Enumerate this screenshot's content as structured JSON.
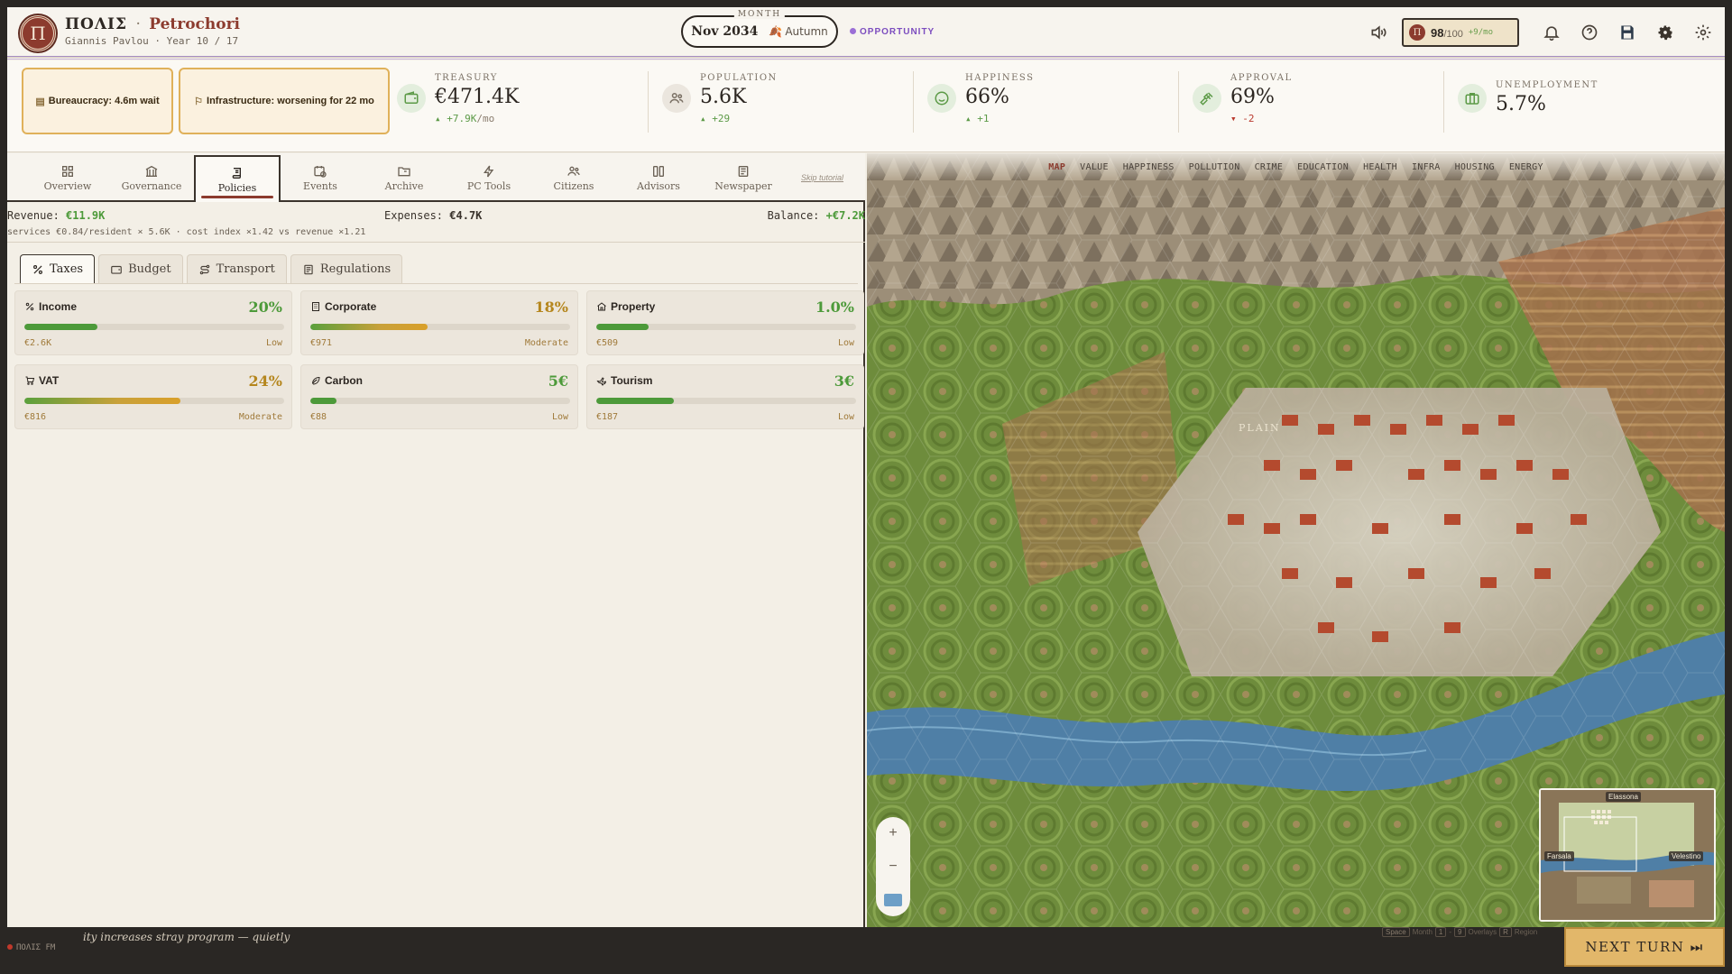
{
  "header": {
    "logo_letter": "Π",
    "game_name": "ΠΟΛΙΣ",
    "separator": "·",
    "city_name": "Petrochori",
    "mayor": "Giannis Pavlou",
    "year": "Year 10 / 17",
    "month_label": "MONTH",
    "date": "Nov 2034",
    "season": "Autumn",
    "opportunity": "OPPORTUNITY",
    "score": "98",
    "score_max": "/100",
    "score_rate": "+9/mo"
  },
  "alerts": [
    {
      "text": "Bureaucracy: 4.6m wait",
      "icon": "clipboard-icon"
    },
    {
      "text": "Infrastructure: worsening for 22 mo",
      "icon": "construction-icon"
    }
  ],
  "stats": {
    "treasury": {
      "label": "TREASURY",
      "value": "€471.4K",
      "delta": "▴ +7.9K",
      "unit": "/mo"
    },
    "population": {
      "label": "POPULATION",
      "value": "5.6K",
      "delta": "▴ +29"
    },
    "happiness": {
      "label": "HAPPINESS",
      "value": "66%",
      "delta": "▴ +1"
    },
    "approval": {
      "label": "APPROVAL",
      "value": "69%",
      "delta": "▾ -2"
    },
    "unemployment": {
      "label": "UNEMPLOYMENT",
      "value": "5.7%"
    }
  },
  "tabs": [
    "Overview",
    "Governance",
    "Policies",
    "Events",
    "Archive",
    "PC Tools",
    "Citizens",
    "Advisors",
    "Newspaper"
  ],
  "skip_tutorial": "Skip tutorial",
  "budget": {
    "revenue_label": "Revenue:",
    "revenue": "€11.9K",
    "expenses_label": "Expenses:",
    "expenses": "€4.7K",
    "balance_label": "Balance:",
    "balance": "+€7.2K",
    "formula": "services €0.84/resident × 5.6K · cost index ×1.42 vs revenue ×1.21"
  },
  "subtabs": [
    "Taxes",
    "Budget",
    "Transport",
    "Regulations"
  ],
  "taxes": [
    {
      "name": "Income",
      "rate": "20%",
      "fill": 0.28,
      "amount": "€2.6K",
      "level": "Low",
      "color": "green"
    },
    {
      "name": "Corporate",
      "rate": "18%",
      "fill": 0.45,
      "amount": "€971",
      "level": "Moderate",
      "color": "amber"
    },
    {
      "name": "Property",
      "rate": "1.0%",
      "fill": 0.2,
      "amount": "€509",
      "level": "Low",
      "color": "green"
    },
    {
      "name": "VAT",
      "rate": "24%",
      "fill": 0.6,
      "amount": "€816",
      "level": "Moderate",
      "color": "amber"
    },
    {
      "name": "Carbon",
      "rate": "5€",
      "fill": 0.1,
      "amount": "€88",
      "level": "Low",
      "color": "green"
    },
    {
      "name": "Tourism",
      "rate": "3€",
      "fill": 0.3,
      "amount": "€187",
      "level": "Low",
      "color": "green"
    }
  ],
  "map": {
    "overlays": [
      "MAP",
      "VALUE",
      "HAPPINESS",
      "POLLUTION",
      "CRIME",
      "EDUCATION",
      "HEALTH",
      "INFRA",
      "HOUSING",
      "ENERGY"
    ],
    "active_overlay": "MAP",
    "region_label": "PLAIN",
    "zoom_in": "+",
    "zoom_out": "−",
    "minimap_towns": [
      "Elassona",
      "Farsala",
      "Velestino"
    ]
  },
  "bottom": {
    "radio": "ΠΟΛΙΣ FM",
    "ticker": "ity increases stray program — quietly",
    "hint_space": "Space",
    "hint_month": "Month",
    "hint_k1": "1",
    "hint_k9": "9",
    "hint_overlays": "Overlays",
    "hint_r": "R",
    "hint_region": "Region",
    "next_turn": "NEXT TURN ⏭"
  }
}
